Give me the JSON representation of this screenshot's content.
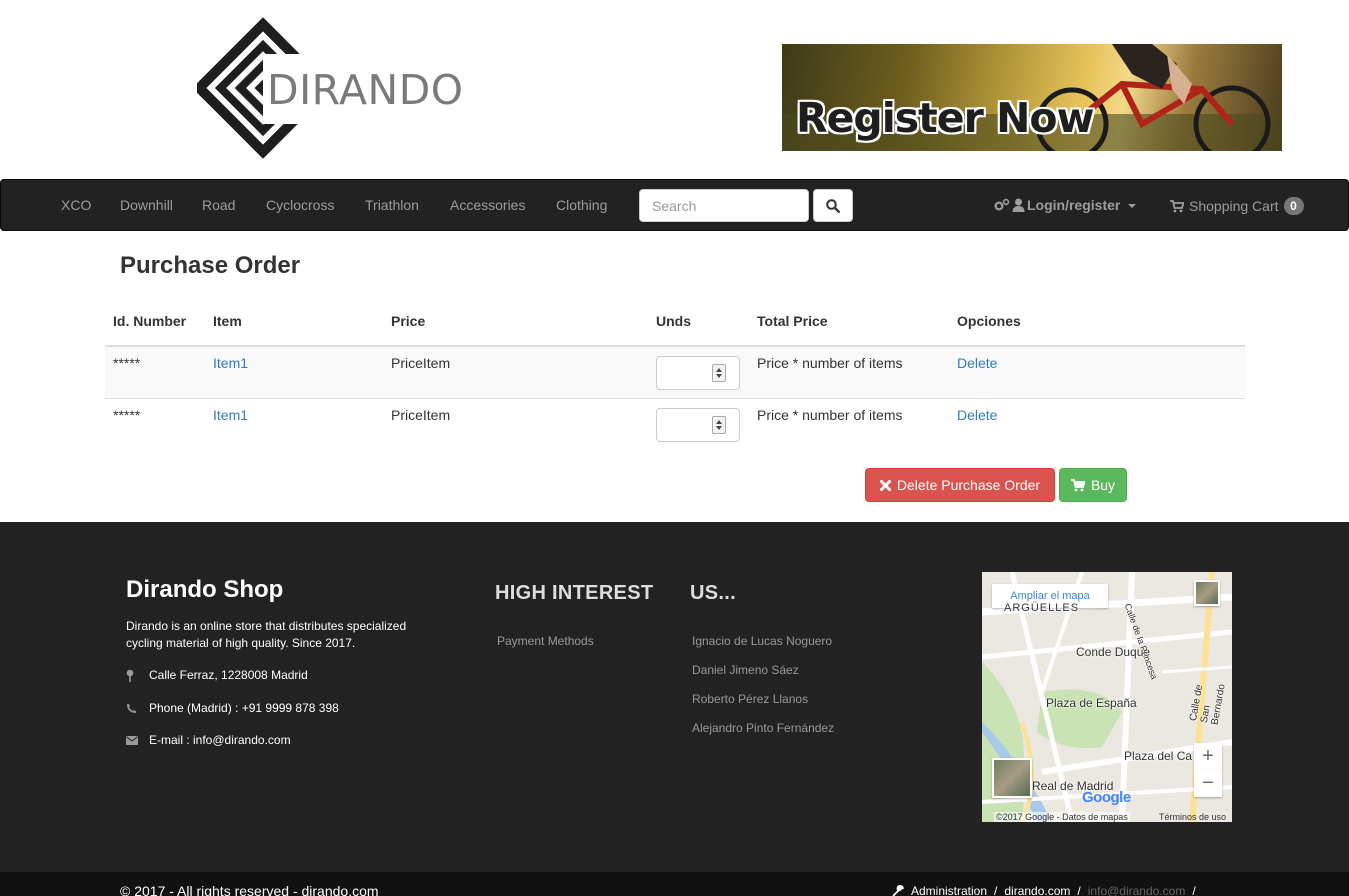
{
  "header": {
    "logo_text": "DIRANDO",
    "banner_text": "Register Now"
  },
  "nav": {
    "items": [
      {
        "label": "XCO"
      },
      {
        "label": "Downhill"
      },
      {
        "label": "Road"
      },
      {
        "label": "Cyclocross"
      },
      {
        "label": "Triathlon"
      },
      {
        "label": "Accessories"
      },
      {
        "label": "Clothing"
      }
    ],
    "search_placeholder": "Search",
    "search_icon": "search-icon",
    "login_label": "Login/register",
    "cart_label": "Shopping Cart",
    "cart_count": "0"
  },
  "main": {
    "title": "Purchase Order",
    "columns": [
      "Id. Number",
      "Item",
      "Price",
      "Unds",
      "Total Price",
      "Opciones"
    ],
    "rows": [
      {
        "id": "*****",
        "item": "Item1",
        "price": "PriceItem",
        "total": "Price * number of items",
        "option": "Delete"
      },
      {
        "id": "*****",
        "item": "Item1",
        "price": "PriceItem",
        "total": "Price * number of items",
        "option": "Delete"
      }
    ],
    "delete_order_label": "Delete Purchase Order",
    "buy_label": "Buy"
  },
  "footer": {
    "title": "Dirando Shop",
    "description": "Dirando is an online store that distributes specialized cycling material of high quality. Since 2017.",
    "address": "Calle Ferraz, 1228008 Madrid",
    "phone": "Phone (Madrid) : +91 9999 878 398",
    "email": "E-mail : info@dirando.com",
    "high_interest_title": "HIGH INTEREST",
    "high_interest_links": [
      "Payment Methods"
    ],
    "us_title": "US...",
    "us_links": [
      "Ignacio de Lucas Noguero",
      "Daniel Jimeno Sáez",
      "Roberto Pérez Llanos",
      "Alejandro Pinto Fernández"
    ],
    "map": {
      "enlarge_label": "Ampliar el mapa",
      "labels": [
        "ARGÜELLES",
        "Conde Duque",
        "Plaza de España",
        "Plaza del Ca",
        "Real de Madrid",
        "Calle de San Bernardo",
        "Calle de la Princesa"
      ],
      "attribution": "©2017 Google - Datos de mapas",
      "terms": "Términos de uso",
      "google": "Google"
    }
  },
  "bottom": {
    "copyright": "© 2017 - All rights reserved - dirando.com",
    "links": [
      "Administration",
      "dirando.com",
      "info@dirando.com"
    ]
  }
}
